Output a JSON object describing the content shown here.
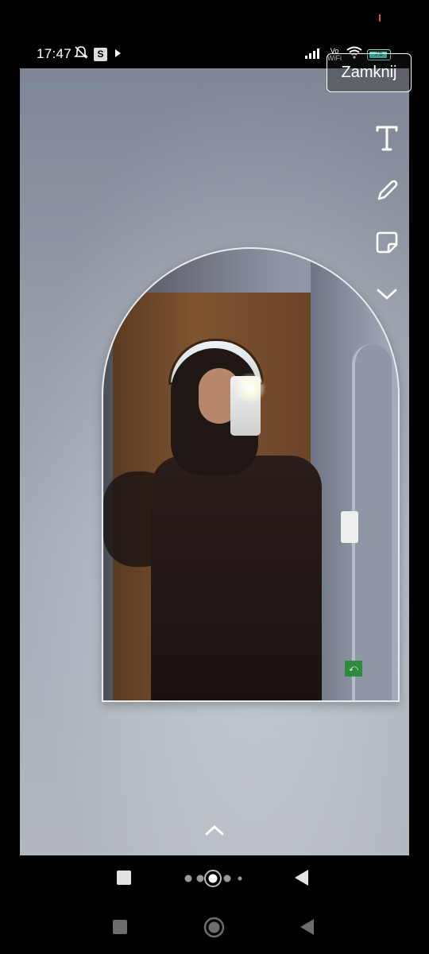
{
  "status_bar": {
    "time": "17:47",
    "sim_badge": "S",
    "vowifi_line1": "Vo",
    "vowifi_line2": "WiFi",
    "battery_level": "76"
  },
  "story": {
    "close_label": "Zamknij"
  },
  "toolbar": {
    "icons": [
      "text-tool-icon",
      "pencil-icon",
      "sticker-icon",
      "chevron-down-icon"
    ]
  },
  "colors": {
    "accent_battery": "#46e0c8",
    "status_orange": "#e8542a",
    "exit_sign_green": "#2e8a3d"
  }
}
